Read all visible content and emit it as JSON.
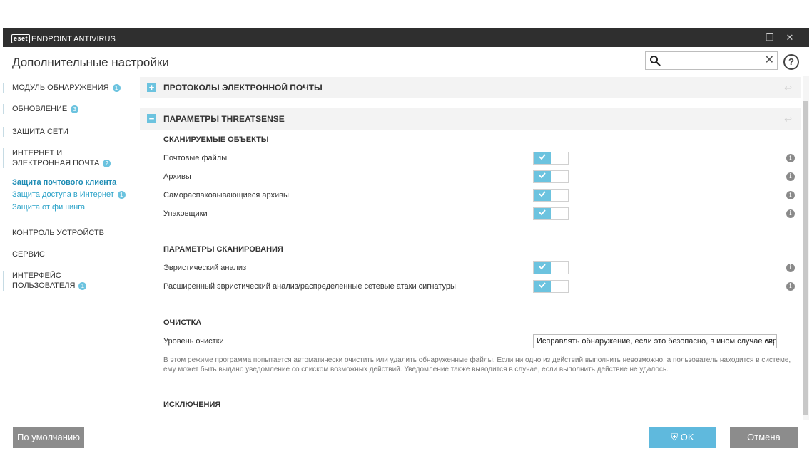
{
  "app": {
    "logo_badge": "eset",
    "logo_text": "ENDPOINT ANTIVIRUS",
    "window_title": "Дополнительные настройки"
  },
  "search": {
    "value": "",
    "placeholder": ""
  },
  "sidebar": {
    "items": [
      {
        "label": "МОДУЛЬ ОБНАРУЖЕНИЯ",
        "badge": "1"
      },
      {
        "label": "ОБНОВЛЕНИЕ",
        "badge": "3"
      },
      {
        "label": "ЗАЩИТА СЕТИ",
        "badge": ""
      },
      {
        "label": "ИНТЕРНЕТ И ЭЛЕКТРОННАЯ ПОЧТА",
        "badge": "2"
      },
      {
        "label": "КОНТРОЛЬ УСТРОЙСТВ",
        "badge": ""
      },
      {
        "label": "СЕРВИС",
        "badge": ""
      },
      {
        "label": "ИНТЕРФЕЙС ПОЛЬЗОВАТЕЛЯ",
        "badge": "1"
      }
    ],
    "sub_items": [
      {
        "label": "Защита почтового клиента",
        "badge": ""
      },
      {
        "label": "Защита доступа в Интернет",
        "badge": "1"
      },
      {
        "label": "Защита от фишинга",
        "badge": ""
      }
    ]
  },
  "sections": {
    "protocols": {
      "title": "ПРОТОКОЛЫ ЭЛЕКТРОННОЙ ПОЧТЫ",
      "toggle": "+"
    },
    "threatsense": {
      "title": "ПАРАМЕТРЫ THREATSENSE",
      "toggle": "−"
    }
  },
  "scan_objects": {
    "title": "СКАНИРУЕМЫЕ ОБЪЕКТЫ",
    "rows": [
      {
        "label": "Почтовые файлы",
        "enabled": true
      },
      {
        "label": "Архивы",
        "enabled": true
      },
      {
        "label": "Самораспаковывающиеся архивы",
        "enabled": true
      },
      {
        "label": "Упаковщики",
        "enabled": true
      }
    ]
  },
  "scan_params": {
    "title": "ПАРАМЕТРЫ СКАНИРОВАНИЯ",
    "rows": [
      {
        "label": "Эвристический анализ",
        "enabled": true
      },
      {
        "label": "Расширенный эвристический анализ/распределенные сетевые атаки сигнатуры",
        "enabled": true
      }
    ]
  },
  "cleaning": {
    "title": "ОЧИСТКА",
    "level_label": "Уровень очистки",
    "level_value": "Исправлять обнаружение, если это безопасно, в ином случае спр...",
    "description": "В этом режиме программа попытается автоматически очистить или удалить обнаруженные файлы. Если ни одно из действий выполнить невозможно, а пользователь находится в системе, ему может быть выдано уведомление со списком возможных действий. Уведомление также выводится в случае, если выполнить действие не удалось."
  },
  "exclusions": {
    "title": "ИСКЛЮЧЕНИЯ"
  },
  "footer": {
    "default_label": "По умолчанию",
    "ok_label": "OK",
    "cancel_label": "Отмена"
  },
  "colors": {
    "accent": "#6cc3df",
    "titlebar": "#2f2f2f",
    "button_gray": "#8c8c8c",
    "button_ok": "#5fb9dd",
    "link": "#2aa2c8"
  }
}
